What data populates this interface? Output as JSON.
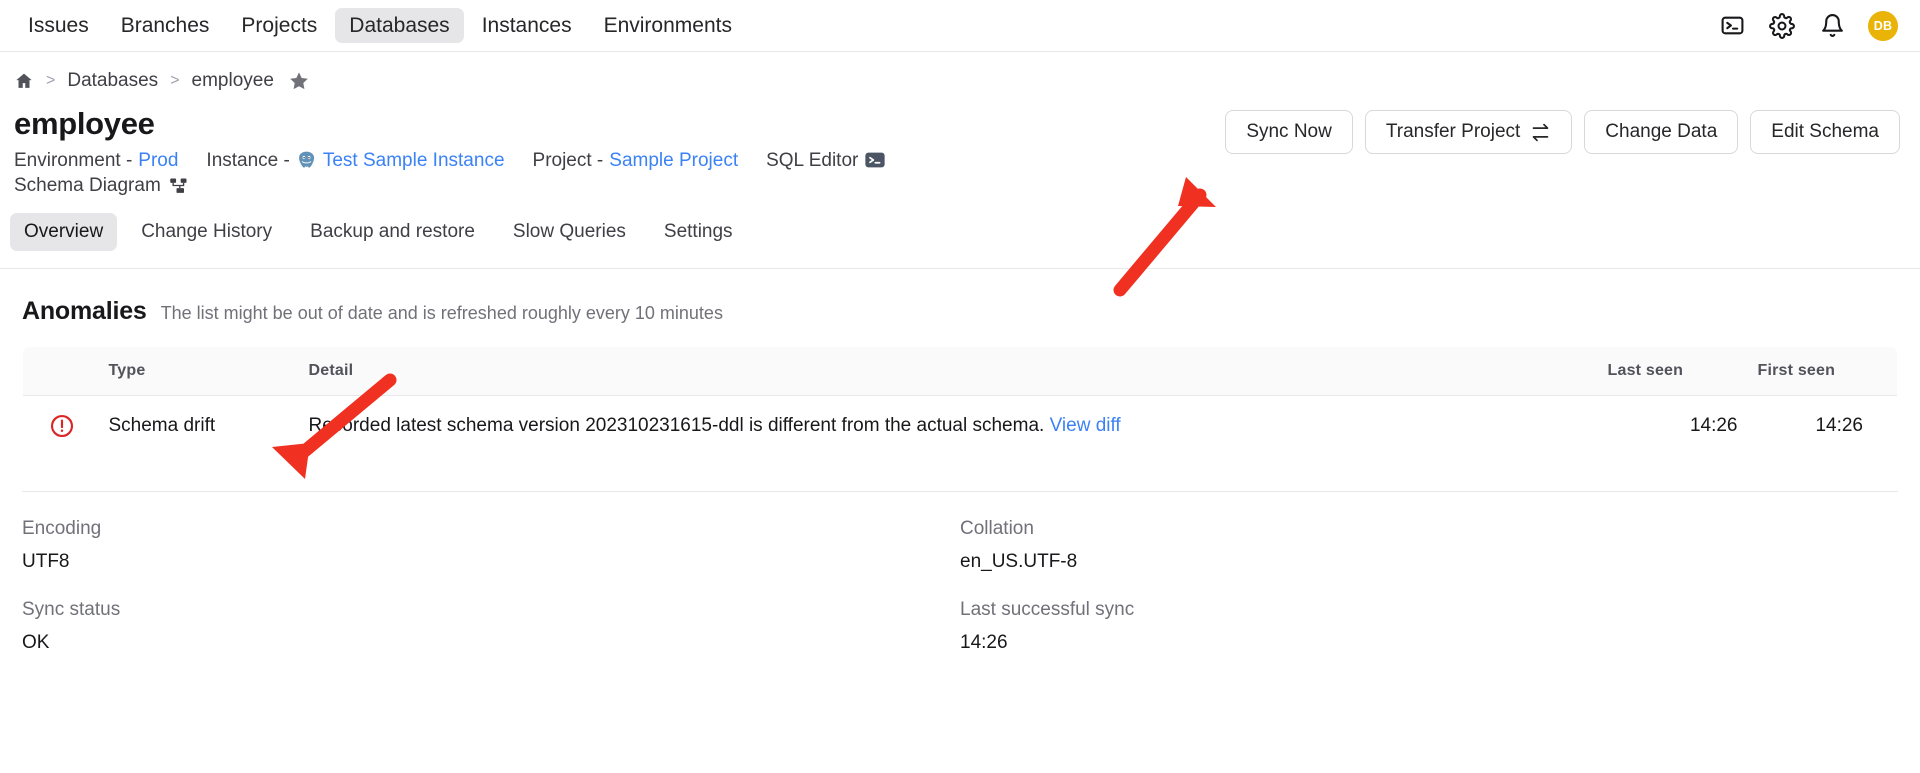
{
  "topnav": {
    "items": [
      {
        "label": "Issues",
        "active": false
      },
      {
        "label": "Branches",
        "active": false
      },
      {
        "label": "Projects",
        "active": false
      },
      {
        "label": "Databases",
        "active": true
      },
      {
        "label": "Instances",
        "active": false
      },
      {
        "label": "Environments",
        "active": false
      }
    ],
    "icons": [
      "terminal-icon",
      "gear-icon",
      "bell-icon"
    ],
    "avatar_initials": "DB",
    "avatar_color": "#eab308"
  },
  "breadcrumb": {
    "home": "home-icon",
    "separator": ">",
    "items": [
      "Databases",
      "employee"
    ],
    "star": "star-icon"
  },
  "header": {
    "title": "employee",
    "meta": {
      "environment_label": "Environment -",
      "environment_value": "Prod",
      "instance_label": "Instance -",
      "instance_value": "Test Sample Instance",
      "instance_icon": "postgresql-elephant-icon",
      "project_label": "Project -",
      "project_value": "Sample Project",
      "sql_editor_label": "SQL Editor",
      "sql_editor_icon": "terminal-icon",
      "schema_diagram_label": "Schema Diagram",
      "schema_diagram_icon": "diagram-icon"
    },
    "actions": [
      {
        "label": "Sync Now",
        "icon": null
      },
      {
        "label": "Transfer Project",
        "icon": "transfer-arrows-icon"
      },
      {
        "label": "Change Data",
        "icon": null
      },
      {
        "label": "Edit Schema",
        "icon": null
      }
    ]
  },
  "tabs": [
    {
      "label": "Overview",
      "active": true
    },
    {
      "label": "Change History",
      "active": false
    },
    {
      "label": "Backup and restore",
      "active": false
    },
    {
      "label": "Slow Queries",
      "active": false
    },
    {
      "label": "Settings",
      "active": false
    }
  ],
  "anomalies": {
    "title": "Anomalies",
    "subtitle": "The list might be out of date and is refreshed roughly every 10 minutes",
    "columns": [
      "",
      "Type",
      "Detail",
      "Last seen",
      "First seen"
    ],
    "rows": [
      {
        "icon": "error-circle-icon",
        "type": "Schema drift",
        "detail": "Recorded latest schema version 202310231615-ddl is different from the actual schema.",
        "detail_link": "View diff",
        "last_seen": "14:26",
        "first_seen": "14:26"
      }
    ]
  },
  "details": [
    {
      "label": "Encoding",
      "value": "UTF8"
    },
    {
      "label": "Collation",
      "value": "en_US.UTF-8"
    },
    {
      "label": "Sync status",
      "value": "OK"
    },
    {
      "label": "Last successful sync",
      "value": "14:26"
    }
  ],
  "annotations": {
    "arrow_color": "#f03020",
    "arrows": [
      {
        "name": "arrow-to-sync-now"
      },
      {
        "name": "arrow-to-anomalies-table"
      }
    ]
  }
}
